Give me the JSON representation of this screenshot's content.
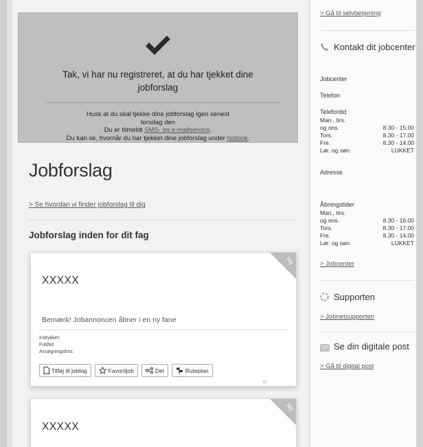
{
  "confirmation": {
    "title": "Tak, vi har nu registreret, at du har tjekket dine jobforslag",
    "reminder_line1": "Husk at du skal tjekke dine jobforslag igen senest",
    "reminder_line2": "torsdag den",
    "subscribed_prefix": "Du er tilmeldt ",
    "subscribed_link": "SMS- og e-mailservice",
    "subscribed_suffix": ".",
    "history_prefix": "Du kan se, hvornår du har tjekket dine jobforslag under ",
    "history_link": "historik",
    "history_suffix": "."
  },
  "main": {
    "heading": "Jobforslag",
    "how_link": "> Se hvordan vi finder jobforslag til dig",
    "section_heading": "Jobforslag inden for dit fag"
  },
  "jobs": [
    {
      "badge": "Ny",
      "title": "XXXXX",
      "notice": "Bemærk! Jobannoncen åbner i en ny fane",
      "meta_added": "Indrykket:",
      "meta_time": "Fuldtid",
      "meta_deadline": "Ansøgningsfrist:",
      "id_label": "Id:",
      "actions": {
        "joblog": "Tilføj til joblog",
        "favorite": "Favoritjob",
        "share": "Del",
        "route": "Ruteplan"
      }
    },
    {
      "badge": "Ny",
      "title": "XXXXX"
    }
  ],
  "sidebar": {
    "selfservice_link": "> Gå til selvbetjening",
    "contact_title": "Kontakt dit jobcenter",
    "jobcenter_label": "Jobcenter",
    "phone_label": "Telefon",
    "phone_hours_label": "Telefontid",
    "phone_hours": [
      {
        "day": "Man., tirs.",
        "time": ""
      },
      {
        "day": "og ons.",
        "time": "8.30 - 15.00"
      },
      {
        "day": "Tors.",
        "time": "8.30 - 17.00"
      },
      {
        "day": "Fre.",
        "time": "8.30 - 14.00"
      },
      {
        "day": "Lør. og søn.",
        "time": "LUKKET"
      }
    ],
    "address_label": "Adresse",
    "opening_hours_label": "Åbningstider",
    "opening_hours": [
      {
        "day": "Man., tirs.",
        "time": ""
      },
      {
        "day": "og ons.",
        "time": "8.30 - 16.00"
      },
      {
        "day": "Tors.",
        "time": "8.30 - 17.00"
      },
      {
        "day": "Fre.",
        "time": "8.30 - 14.00"
      },
      {
        "day": "Lør. og søn.",
        "time": "LUKKET"
      }
    ],
    "jobcenter_link": "> Jobcenter",
    "support_title": "Supporten",
    "support_link": "> Jobnetsupporten",
    "digital_post_title": "Se din digitale post",
    "digital_post_link": "> Gå til digital post"
  },
  "colors": {
    "confirm_bg": "#bfbfbf",
    "ribbon": "#bdbdbd",
    "page_bg": "#f2f2f2"
  }
}
